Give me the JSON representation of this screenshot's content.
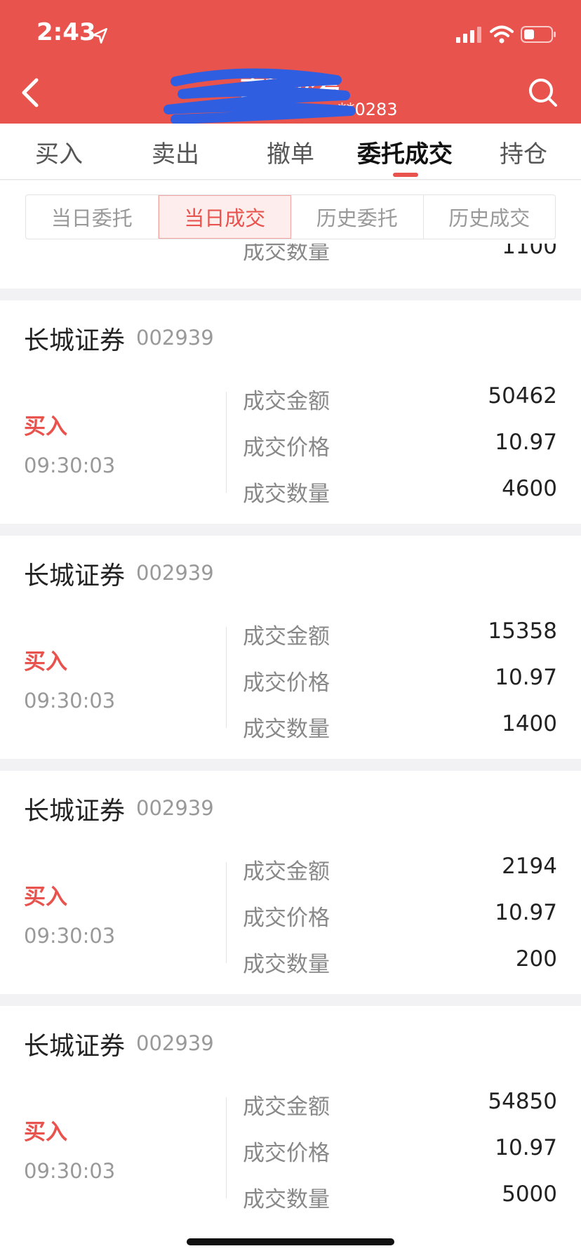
{
  "status_bar": {
    "time": "2:43"
  },
  "header": {
    "title": "委托交易",
    "account": "**0283"
  },
  "tabs": [
    {
      "label": "买入"
    },
    {
      "label": "卖出"
    },
    {
      "label": "撤单"
    },
    {
      "label": "委托成交"
    },
    {
      "label": "持仓"
    }
  ],
  "segments": [
    {
      "label": "当日委托"
    },
    {
      "label": "当日成交"
    },
    {
      "label": "历史委托"
    },
    {
      "label": "历史成交"
    }
  ],
  "peek_row": {
    "label": "成交数量",
    "value": "1100"
  },
  "trades": [
    {
      "name": "长城证券",
      "code": "002939",
      "side": "买入",
      "time": "09:30:03",
      "amount_label": "成交金额",
      "amount": "50462",
      "price_label": "成交价格",
      "price": "10.97",
      "qty_label": "成交数量",
      "qty": "4600"
    },
    {
      "name": "长城证券",
      "code": "002939",
      "side": "买入",
      "time": "09:30:03",
      "amount_label": "成交金额",
      "amount": "15358",
      "price_label": "成交价格",
      "price": "10.97",
      "qty_label": "成交数量",
      "qty": "1400"
    },
    {
      "name": "长城证券",
      "code": "002939",
      "side": "买入",
      "time": "09:30:03",
      "amount_label": "成交金额",
      "amount": "2194",
      "price_label": "成交价格",
      "price": "10.97",
      "qty_label": "成交数量",
      "qty": "200"
    },
    {
      "name": "长城证券",
      "code": "002939",
      "side": "买入",
      "time": "09:30:03",
      "amount_label": "成交金额",
      "amount": "54850",
      "price_label": "成交价格",
      "price": "10.97",
      "qty_label": "成交数量",
      "qty": "5000"
    }
  ],
  "colors": {
    "brand": "#e8534e",
    "scribble": "#2f5fe0"
  }
}
